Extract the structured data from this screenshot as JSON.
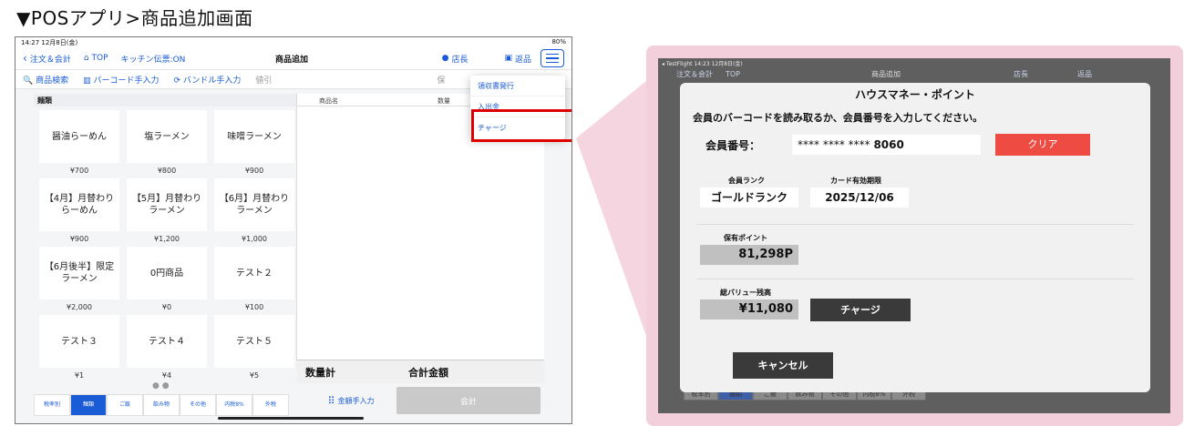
{
  "caption": "▼POSアプリ>商品追加画面",
  "pos": {
    "status_time": "14:27  12月8日(金)",
    "status_right": "80%",
    "nav": {
      "back": "注文＆会計",
      "top": "TOP",
      "kitchen": "キッチン伝票:ON",
      "title": "商品追加",
      "staff": "店長",
      "return": "返品"
    },
    "toolbar": {
      "search": "商品検索",
      "barcode": "バーコード手入力",
      "bundle": "バンドル手入力",
      "discount": "値引",
      "hold": "保"
    },
    "category": "麺類",
    "products": [
      {
        "name": "醤油らーめん",
        "price": "¥700"
      },
      {
        "name": "塩ラーメン",
        "price": "¥800"
      },
      {
        "name": "味噌ラーメン",
        "price": "¥900"
      },
      {
        "name": "【4月】月替わりらーめん",
        "price": "¥900"
      },
      {
        "name": "【5月】月替わりラーメン",
        "price": "¥1,200"
      },
      {
        "name": "【6月】月替わりラーメン",
        "price": "¥1,000"
      },
      {
        "name": "【6月後半】限定ラーメン",
        "price": "¥2,000"
      },
      {
        "name": "0円商品",
        "price": "¥0"
      },
      {
        "name": "テスト２",
        "price": "¥100"
      },
      {
        "name": "テスト３",
        "price": "¥1"
      },
      {
        "name": "テスト４",
        "price": "¥4"
      },
      {
        "name": "テスト５",
        "price": "¥5"
      }
    ],
    "page_dots": "● ●",
    "list_headers": {
      "name": "商品名",
      "qty": "数量"
    },
    "totals": {
      "qty": "数量計",
      "amount": "合計金額"
    },
    "bottom_tabs": [
      "税率別",
      "麺類",
      "ご飯",
      "飲み物",
      "その他",
      "内税8%",
      "外税"
    ],
    "amount_entry": "金額手入力",
    "checkout": "会計",
    "menu": [
      "領収書発行",
      "入出金",
      "チャージ"
    ]
  },
  "dialog": {
    "bg_status": "◂ TestFlight  14:23  12月8日(金)",
    "bg_nav": [
      "注文＆会計",
      "TOP",
      "商品追加",
      "店長",
      "返品"
    ],
    "bg_tabs": [
      "税率別",
      "麺類",
      "ご飯",
      "飲み物",
      "その他",
      "内税8%",
      "外税"
    ],
    "title": "ハウスマネー・ポイント",
    "message": "会員のバーコードを読み取るか、会員番号を入力してください。",
    "member_label": "会員番号：",
    "member_masked": "**** **** **** ",
    "member_last": "8060",
    "clear": "クリア",
    "rank_label": "会員ランク",
    "rank_value": "ゴールドランク",
    "expiry_label": "カード有効期限",
    "expiry_value": "2025/12/06",
    "points_label": "保有ポイント",
    "points_value": "81,298P",
    "balance_label": "総バリュー残高",
    "balance_value": "¥11,080",
    "charge": "チャージ",
    "cancel": "キャンセル"
  },
  "colors": {
    "accent": "#1a5cd6",
    "highlight": "#e00000",
    "clear_button": "#ee4b43",
    "frame": "#f3cedb"
  }
}
